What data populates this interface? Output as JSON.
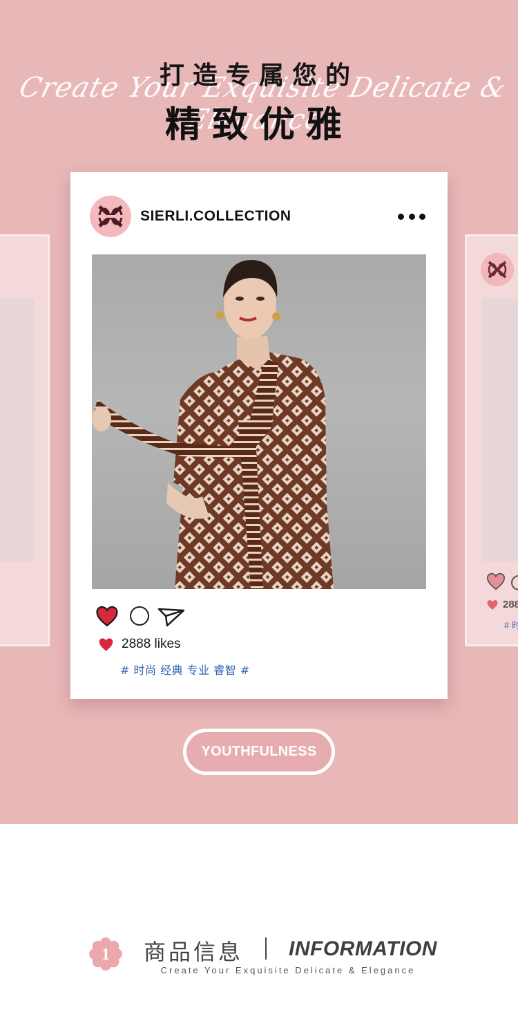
{
  "header": {
    "title_line1": "打造专属您的",
    "script_line": "Create Your Exquisite Delicate & Elegance",
    "title_line2": "精致优雅"
  },
  "post": {
    "account_name": "SIERLI.COLLECTION",
    "avatar_icon": "sierli-logo-icon",
    "more_icon": "more-dots-icon",
    "photo_alt": "Model in brown geometric print dress with neck scarf",
    "actions": {
      "like_icon": "heart-icon",
      "comment_icon": "comment-circle-icon",
      "share_icon": "paper-plane-icon"
    },
    "likes_text": "2888 likes",
    "hashtags": "# 时尚 经典 专业 睿智 #"
  },
  "side_card": {
    "likes_text": "288",
    "tag_fragment": "# 时"
  },
  "badge": {
    "label": "YOUTHFULNESS"
  },
  "info_section": {
    "number": "1",
    "title_cn": "商品信息",
    "title_en": "INFORMATION",
    "subtitle": "Create Your Exquisite Delicate & Elegance"
  },
  "colors": {
    "hero_bg": "#e8b7b8",
    "accent_heart": "#d9283d",
    "hashtag_blue": "#2f62b0",
    "pill_bg": "#e7acaf"
  }
}
